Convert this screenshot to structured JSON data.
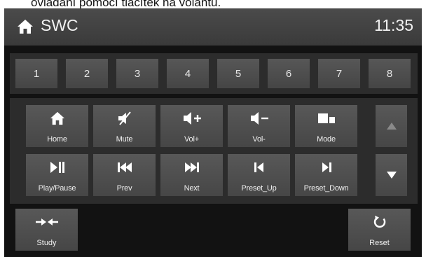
{
  "caption": "ovládání pomocí tlačítek na volantu.",
  "header": {
    "title": "SWC",
    "time": "11:35",
    "home_icon": "home-icon"
  },
  "number_buttons": [
    "1",
    "2",
    "3",
    "4",
    "5",
    "6",
    "7",
    "8"
  ],
  "function_buttons": {
    "row1": [
      {
        "label": "Home",
        "icon": "home-icon"
      },
      {
        "label": "Mute",
        "icon": "mute-icon"
      },
      {
        "label": "Vol+",
        "icon": "volume-up-icon"
      },
      {
        "label": "Vol-",
        "icon": "volume-down-icon"
      },
      {
        "label": "Mode",
        "icon": "mode-icon"
      }
    ],
    "row2": [
      {
        "label": "Play/Pause",
        "icon": "play-pause-icon"
      },
      {
        "label": "Prev",
        "icon": "previous-icon"
      },
      {
        "label": "Next",
        "icon": "next-icon"
      },
      {
        "label": "Preset_Up",
        "icon": "preset-up-icon"
      },
      {
        "label": "Preset_Down",
        "icon": "preset-down-icon"
      }
    ]
  },
  "scroll": {
    "up_icon": "arrow-up-icon",
    "down_icon": "arrow-down-icon"
  },
  "bottom": {
    "study_label": "Study",
    "study_icon": "study-arrows-icon",
    "reset_label": "Reset",
    "reset_icon": "reset-icon"
  },
  "colors": {
    "background": "#121212",
    "header": "#404040",
    "panel": "#2c2c2c",
    "button": "#505050",
    "text": "#f0f0f0"
  }
}
